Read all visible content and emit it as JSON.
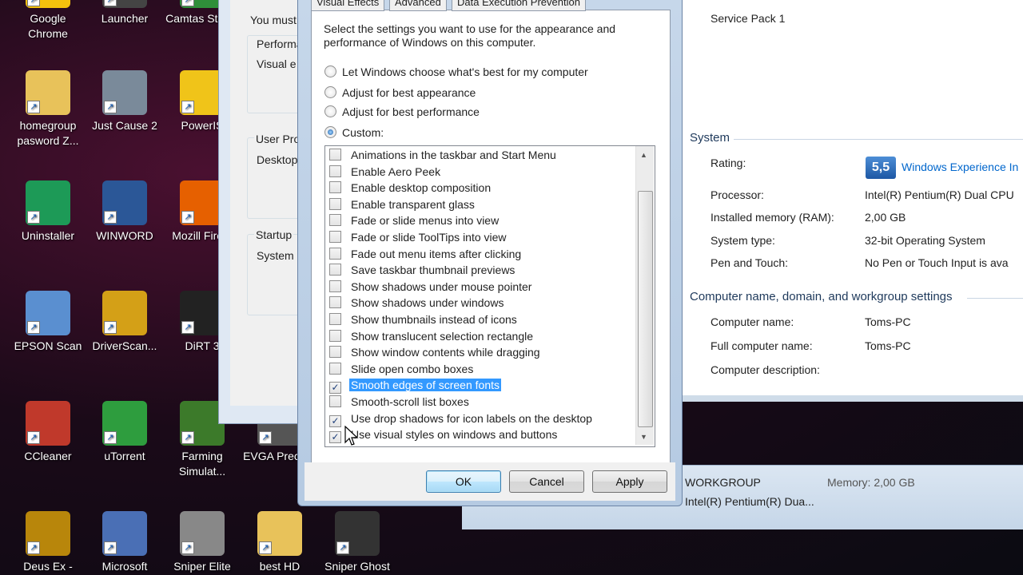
{
  "desktop_icons": [
    {
      "label": "Google Chrome",
      "color": "#f4c20d",
      "icon": "chrome-icon"
    },
    {
      "label": "Launcher",
      "color": "#444444",
      "icon": "launcher-icon"
    },
    {
      "label": "Camtas Studio",
      "color": "#2f8f3a",
      "icon": "camtasia-icon"
    },
    {
      "label": "homegroup pasword Z...",
      "color": "#e8c25a",
      "icon": "folder-icon"
    },
    {
      "label": "Just Cause 2",
      "color": "#7a8a9a",
      "icon": "game-icon"
    },
    {
      "label": "PowerIS",
      "color": "#f0c419",
      "icon": "disc-icon"
    },
    {
      "label": "Uninstaller",
      "color": "#1d9a57",
      "icon": "uninstaller-icon"
    },
    {
      "label": "WINWORD",
      "color": "#2b5797",
      "icon": "word-icon"
    },
    {
      "label": "Mozill Firefo",
      "color": "#e66000",
      "icon": "firefox-icon"
    },
    {
      "label": "EPSON Scan",
      "color": "#5a8fd0",
      "icon": "scanner-icon"
    },
    {
      "label": "DriverScan...",
      "color": "#d4a017",
      "icon": "driverscan-icon"
    },
    {
      "label": "DiRT 3",
      "color": "#222222",
      "icon": "dirt-icon"
    },
    {
      "label": "CCleaner",
      "color": "#c0392b",
      "icon": "ccleaner-icon"
    },
    {
      "label": "uTorrent",
      "color": "#2e9d3e",
      "icon": "utorrent-icon"
    },
    {
      "label": "Farming Simulat...",
      "color": "#3c7a2a",
      "icon": "tractor-icon"
    },
    {
      "label": "EVGA Precisio",
      "color": "#555555",
      "icon": "evga-icon"
    },
    {
      "label": "Deus Ex -",
      "color": "#b8860b",
      "icon": "deusex-icon"
    },
    {
      "label": "Microsoft",
      "color": "#4a6fb5",
      "icon": "visio-icon"
    },
    {
      "label": "Sniper Elite",
      "color": "#888888",
      "icon": "sniper-elite-icon"
    },
    {
      "label": "best HD",
      "color": "#e8c25a",
      "icon": "folder-icon"
    },
    {
      "label": "Sniper Ghost",
      "color": "#333333",
      "icon": "crosshair-icon"
    }
  ],
  "perf_window": {
    "you_must": "You must",
    "performance": "Performa",
    "visual_e": "Visual e",
    "user_profiles": "User Pro",
    "desktop": "Desktop",
    "startup": "Startup",
    "system": "System"
  },
  "dialog": {
    "tabs": [
      "Visual Effects",
      "Advanced",
      "Data Execution Prevention"
    ],
    "description": "Select the settings you want to use for the appearance and performance of Windows on this computer.",
    "radios": [
      {
        "label": "Let Windows choose what's best for my computer",
        "checked": false
      },
      {
        "label": "Adjust for best appearance",
        "checked": false
      },
      {
        "label": "Adjust for best performance",
        "checked": false
      },
      {
        "label": "Custom:",
        "checked": true
      }
    ],
    "effects": [
      {
        "label": "Animations in the taskbar and Start Menu",
        "checked": false
      },
      {
        "label": "Enable Aero Peek",
        "checked": false
      },
      {
        "label": "Enable desktop composition",
        "checked": false
      },
      {
        "label": "Enable transparent glass",
        "checked": false
      },
      {
        "label": "Fade or slide menus into view",
        "checked": false
      },
      {
        "label": "Fade or slide ToolTips into view",
        "checked": false
      },
      {
        "label": "Fade out menu items after clicking",
        "checked": false
      },
      {
        "label": "Save taskbar thumbnail previews",
        "checked": false
      },
      {
        "label": "Show shadows under mouse pointer",
        "checked": false
      },
      {
        "label": "Show shadows under windows",
        "checked": false
      },
      {
        "label": "Show thumbnails instead of icons",
        "checked": false
      },
      {
        "label": "Show translucent selection rectangle",
        "checked": false
      },
      {
        "label": "Show window contents while dragging",
        "checked": false
      },
      {
        "label": "Slide open combo boxes",
        "checked": false
      },
      {
        "label": "Smooth edges of screen fonts",
        "checked": true,
        "selected": true
      },
      {
        "label": "Smooth-scroll list boxes",
        "checked": false
      },
      {
        "label": "Use drop shadows for icon labels on the desktop",
        "checked": true
      },
      {
        "label": "Use visual styles on windows and buttons",
        "checked": true
      }
    ],
    "buttons": {
      "ok": "OK",
      "cancel": "Cancel",
      "apply": "Apply"
    }
  },
  "system_window": {
    "service_pack": "Service Pack 1",
    "system_heading": "System",
    "rating_label": "Rating:",
    "rating_value": "5,5",
    "rating_link": "Windows Experience In",
    "processor_label": "Processor:",
    "processor_value": "Intel(R) Pentium(R) Dual  CPU",
    "ram_label": "Installed memory (RAM):",
    "ram_value": "2,00 GB",
    "type_label": "System type:",
    "type_value": "32-bit Operating System",
    "pen_label": "Pen and Touch:",
    "pen_value": "No Pen or Touch Input is ava",
    "computer_heading": "Computer name, domain, and workgroup settings",
    "name_label": "Computer name:",
    "name_value": "Toms-PC",
    "full_label": "Full computer name:",
    "full_value": "Toms-PC",
    "desc_label": "Computer description:",
    "workgroup": "WORKGROUP",
    "memory": "Memory: 2,00 GB",
    "cpu_short": "Intel(R) Pentium(R) Dua..."
  }
}
